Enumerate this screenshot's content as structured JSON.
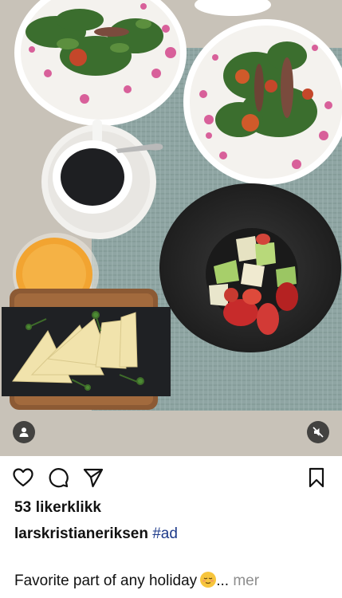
{
  "post": {
    "likes_text": "53 likerklikk",
    "username": "larskristianeriksen",
    "hashtag": "#ad",
    "caption_text": "Favorite part of any holiday",
    "caption_emoji": "relieved-face-emoji",
    "ellipsis": "...",
    "more_label": "mer"
  },
  "icons": {
    "like": "heart-icon",
    "comment": "comment-icon",
    "share": "paper-plane-icon",
    "save": "bookmark-icon",
    "user_tag": "user-icon",
    "mute": "speaker-muted-icon"
  },
  "colors": {
    "hashtag": "#1d3a8a",
    "more": "#8e8e8e",
    "text": "#111111"
  }
}
